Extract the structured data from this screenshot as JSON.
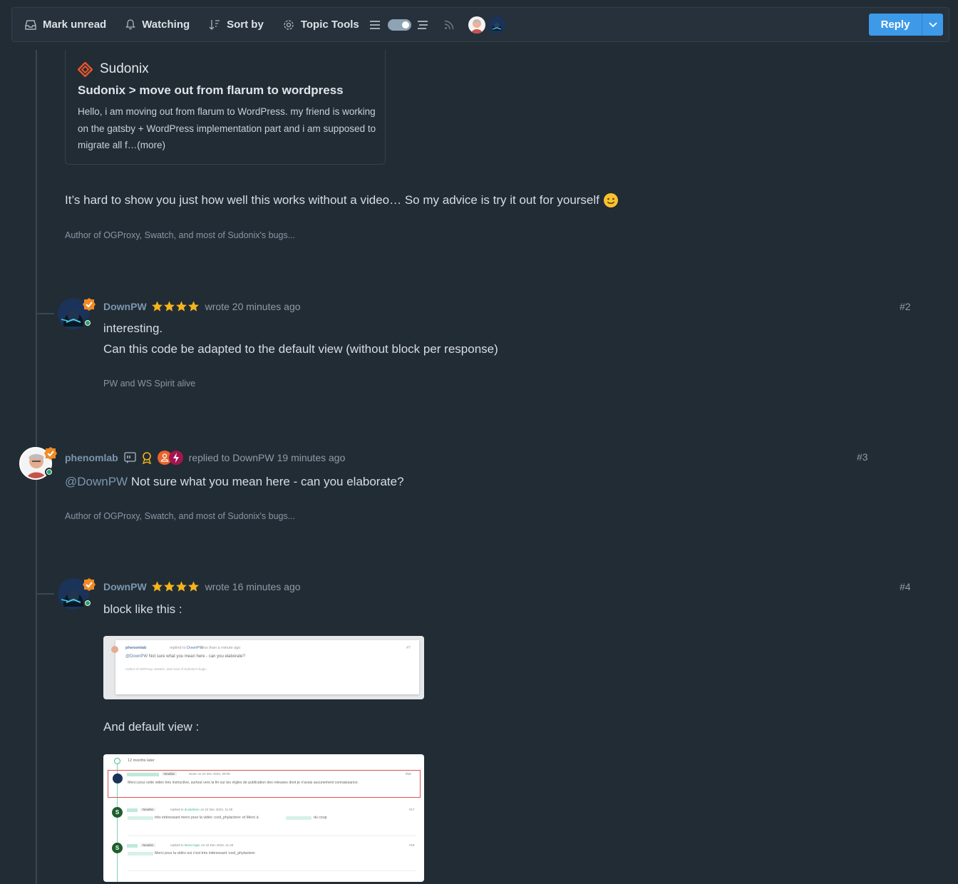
{
  "toolbar": {
    "mark_unread": "Mark unread",
    "watching": "Watching",
    "sort_by": "Sort by",
    "topic_tools": "Topic Tools",
    "reply": "Reply"
  },
  "preview": {
    "site": "Sudonix",
    "title": "Sudonix > move out from flarum to wordpress",
    "description": "Hello, i am moving out from flarum to WordPress. my friend is working on the gatsby + WordPress implementation part and i am supposed to migrate all f…(more)"
  },
  "post1": {
    "body": "It’s hard to show you just how well this works without a video… So my advice is try it out for yourself",
    "signature": "Author of OGProxy, Swatch, and most of Sudonix's bugs..."
  },
  "post2": {
    "username": "DownPW",
    "meta": "wrote 20 minutes ago",
    "number": "#2",
    "line1": "interesting.",
    "line2": "Can this code be adapted to the default view (without block per response)",
    "signature": "PW and WS Spirit alive"
  },
  "post3": {
    "username": "phenomlab",
    "replied_to": "replied to",
    "replied_user": "DownPW",
    "meta": "19 minutes ago",
    "number": "#3",
    "mention": "@DownPW",
    "body": " Not sure what you mean here - can you elaborate?",
    "signature": "Author of OGProxy, Swatch, and most of Sudonix's bugs..."
  },
  "post4": {
    "username": "DownPW",
    "meta": "wrote 16 minutes ago",
    "number": "#4",
    "line1": "block like this :",
    "line2": "And default view :"
  },
  "shot1": {
    "user": "phenomlab",
    "replied": "replied to",
    "target": "DownPW",
    "time": "less than a minute ago",
    "num": "#7",
    "mention": "@DownPW",
    "body": "Not sure what you mean here - can you elaborate?",
    "sig": "Author of OGProxy, Swatch, and most of Sudonix's bugs..."
  },
  "shot2": {
    "later": "12 months later",
    "r1_time": "wrote on 22 Dec 2022, 09:05",
    "r1_num": "#16",
    "r1_body": "Merci pour cette vidéo très instructive, surtout vers la fin sur les règles de publication des releases dont je n'avais aucunement connaissance.",
    "r2_time": "replied to",
    "r2_target": "duJambon",
    "r2_date": "on 22 Dec 2022, 11:29",
    "r2_num": "#17",
    "r2_body": "très intéressant merci pour la vidéo :cool_phylactere: et Merci à",
    "r2_tail": "du coup",
    "r3_time": "replied to",
    "r3_target": "Mono-logic",
    "r3_date": "on 22 Dec 2022, 11:33",
    "r3_num": "#18",
    "r3_body": "Merci pour la vidéo oui c'est très intéressant :cool_phylactere:",
    "badge": "Newbie",
    "avatar_letter": "S"
  },
  "colors": {
    "background": "#222c35",
    "accent": "#3d9ae8",
    "username": "#7c96ad",
    "online": "#27a06b",
    "badge": "#f08a24",
    "stars": "#f5b31c"
  }
}
